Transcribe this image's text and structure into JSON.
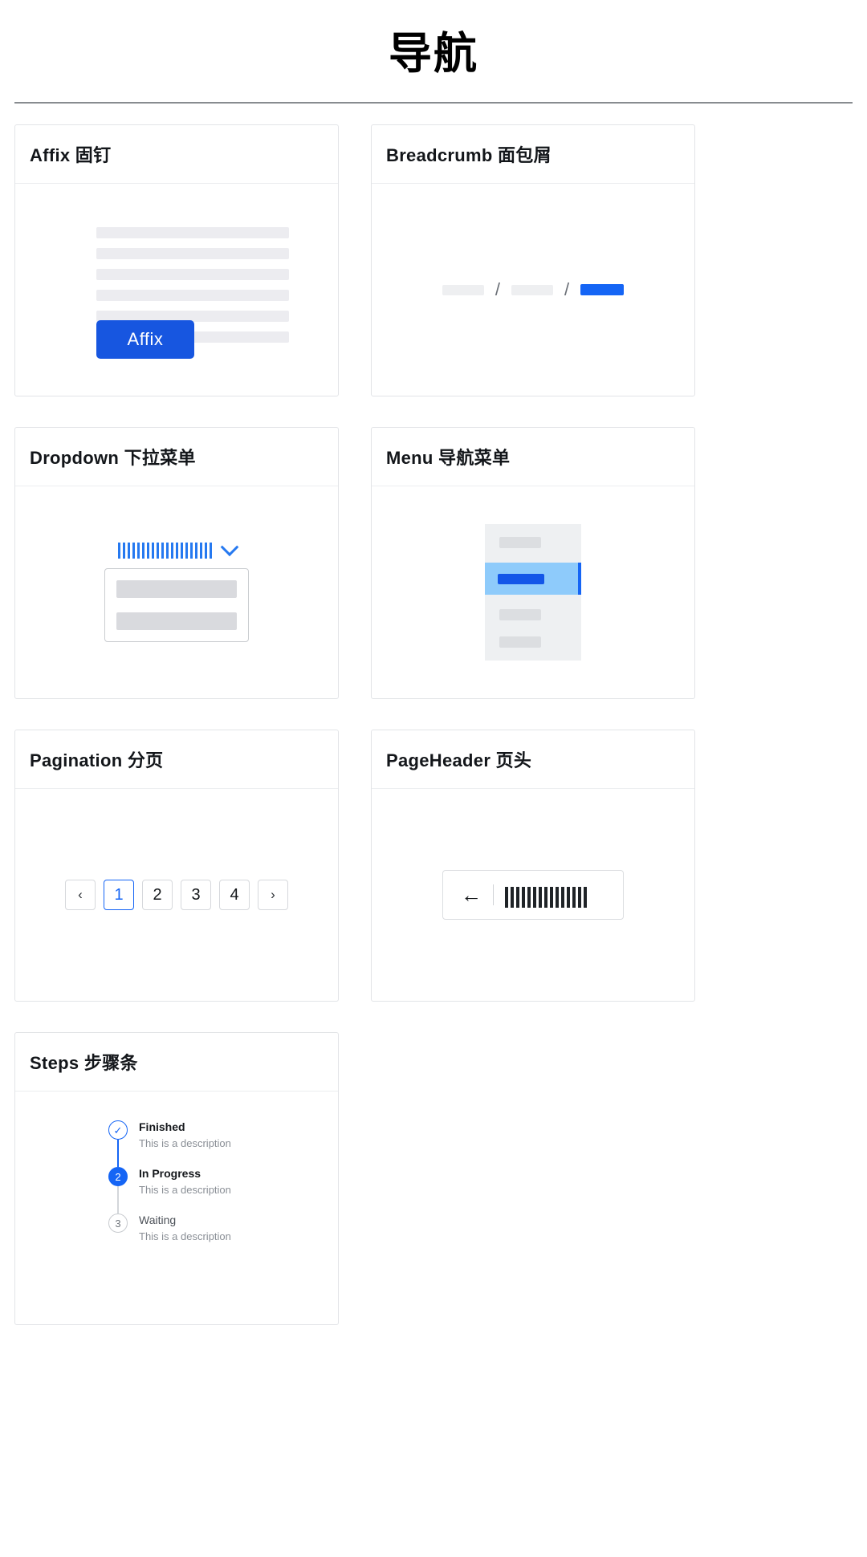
{
  "header": {
    "title": "导航"
  },
  "cards": [
    {
      "id": "affix",
      "title": "Affix 固钉"
    },
    {
      "id": "breadcrumb",
      "title": "Breadcrumb 面包屑"
    },
    {
      "id": "dropdown",
      "title": "Dropdown 下拉菜单"
    },
    {
      "id": "menu",
      "title": "Menu 导航菜单"
    },
    {
      "id": "pagination",
      "title": "Pagination 分页"
    },
    {
      "id": "pageheader",
      "title": "PageHeader 页头"
    },
    {
      "id": "steps",
      "title": "Steps 步骤条"
    }
  ],
  "affix": {
    "button_label": "Affix",
    "placeholder_lines": 6
  },
  "breadcrumb": {
    "separator": "/",
    "items_count": 3,
    "active_index": 2
  },
  "dropdown": {
    "menu_items_count": 2,
    "chevron": "chevron-down"
  },
  "menu": {
    "items_count": 4,
    "selected_index": 1
  },
  "pagination": {
    "prev_label": "‹",
    "next_label": "›",
    "pages": [
      "1",
      "2",
      "3",
      "4"
    ],
    "current_page": "1"
  },
  "pageheader": {
    "back_label": "←"
  },
  "steps": {
    "items": [
      {
        "indicator": "✓",
        "title": "Finished",
        "description": "This is a description",
        "status": "finished"
      },
      {
        "indicator": "2",
        "title": "In Progress",
        "description": "This is a description",
        "status": "process"
      },
      {
        "indicator": "3",
        "title": "Waiting",
        "description": "This is a description",
        "status": "wait"
      }
    ]
  },
  "colors": {
    "primary": "#1565f5",
    "primary_dark": "#1356e8",
    "selected_bg": "#8ecbfb",
    "placeholder": "#ececf0",
    "border": "#e2e4e7"
  }
}
